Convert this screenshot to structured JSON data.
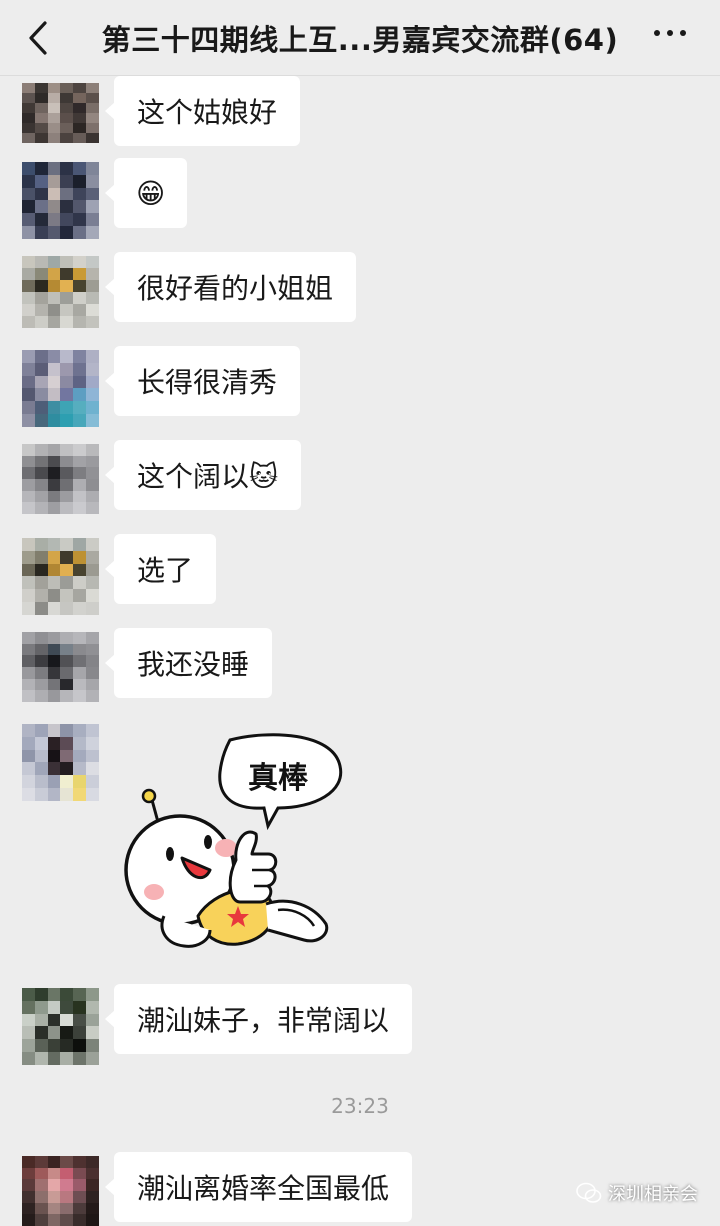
{
  "header": {
    "title": "第三十四期线上互...男嘉宾交流群(64)",
    "back_icon": "chevron-left-icon",
    "more_icon": "ellipsis-icon"
  },
  "messages": [
    {
      "text": "这个姑娘好"
    },
    {
      "text": "😁"
    },
    {
      "text": "很好看的小姐姐"
    },
    {
      "text": "长得很清秀"
    },
    {
      "text": "这个阔以🐱"
    },
    {
      "text": "选了"
    },
    {
      "text": "我还没睡"
    },
    {
      "sticker_text": "真棒"
    },
    {
      "text": "潮汕妹子，非常阔以"
    },
    {
      "text": "潮汕离婚率全国最低"
    }
  ],
  "timestamp": "23:23",
  "watermark": "深圳相亲会",
  "colors": {
    "background": "#ededed",
    "bubble": "#ffffff",
    "text": "#191919",
    "timestamp": "#9a9a9a"
  }
}
